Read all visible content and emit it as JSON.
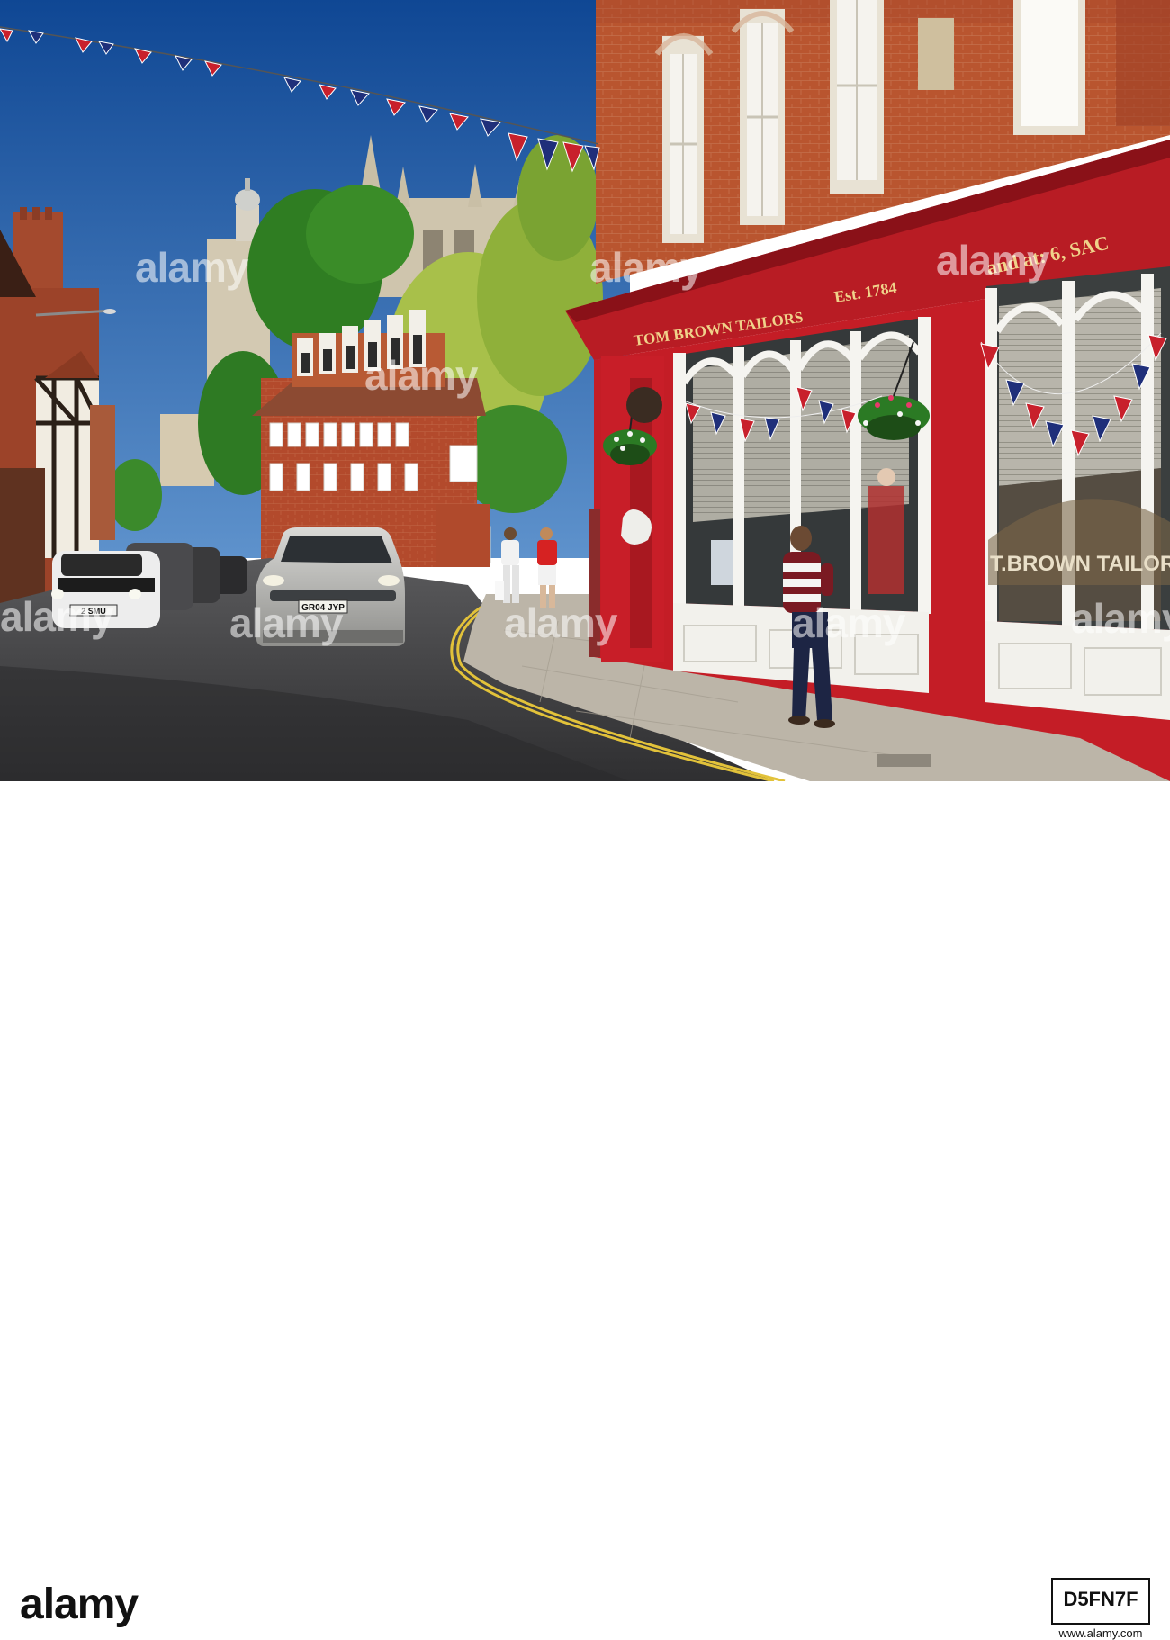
{
  "watermark": {
    "text": "alamy"
  },
  "signs": {
    "fascia_name": "TOM BROWN TAILORS",
    "fascia_est": "Est. 1784",
    "fascia_address": "and at: 6, SAC",
    "window_lettering": "T.BROWN TAILORS"
  },
  "vehicles": {
    "silver_car_plate": "GR04 JYP",
    "mini_plate": "2 SMU"
  },
  "footer": {
    "logo": "alamy",
    "image_id": "D5FN7F",
    "site": "www.alamy.com"
  },
  "colors": {
    "sky": "#1f5aa6",
    "brick": "#b8532f",
    "shopfront_red": "#c81e28",
    "road": "#4a4a4c",
    "pavement": "#b9b3a8"
  }
}
